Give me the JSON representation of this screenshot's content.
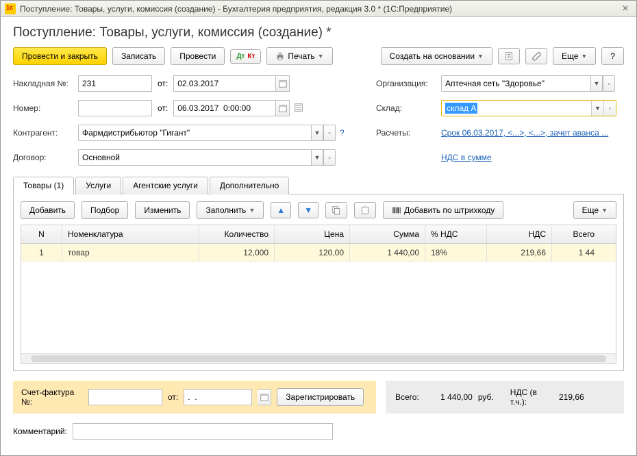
{
  "window": {
    "title": "Поступление: Товары, услуги, комиссия (создание) - Бухгалтерия предприятия, редакция 3.0 *  (1С:Предприятие)"
  },
  "heading": "Поступление: Товары, услуги, комиссия (создание) *",
  "toolbar": {
    "post_close": "Провести и закрыть",
    "save": "Записать",
    "post": "Провести",
    "print": "Печать",
    "create_based": "Создать на основании",
    "more": "Еще",
    "help": "?"
  },
  "form": {
    "invoice_no_label": "Накладная  №:",
    "invoice_no": "231",
    "from1": "от:",
    "date1": "02.03.2017",
    "number_label": "Номер:",
    "number_value": "",
    "from2": "от:",
    "date2": "06.03.2017  0:00:00",
    "contractor_label": "Контрагент:",
    "contractor": "Фармдистрибьютор \"Гигант\"",
    "contract_label": "Договор:",
    "contract": "Основной",
    "org_label": "Организация:",
    "org": "Аптечная сеть \"Здоровье\"",
    "warehouse_label": "Склад:",
    "warehouse_value": "склад А",
    "calc_label": "Расчеты:",
    "calc_link": "Срок 06.03.2017, <...>, <...>, зачет аванса ...",
    "vat_link": "НДС в сумме"
  },
  "tabs": {
    "goods": "Товары (1)",
    "services": "Услуги",
    "agent": "Агентские услуги",
    "extra": "Дополнительно"
  },
  "tbl_toolbar": {
    "add": "Добавить",
    "select": "Подбор",
    "change": "Изменить",
    "fill": "Заполнить",
    "barcode": "Добавить по штрихкоду",
    "more": "Еще"
  },
  "columns": {
    "n": "N",
    "nom": "Номенклатура",
    "qty": "Количество",
    "price": "Цена",
    "sum": "Сумма",
    "vatp": "% НДС",
    "vat": "НДС",
    "total": "Всего"
  },
  "rows": [
    {
      "n": "1",
      "nom": "товар",
      "qty": "12,000",
      "price": "120,00",
      "sum": "1 440,00",
      "vatp": "18%",
      "vat": "219,66",
      "total": "1 44"
    }
  ],
  "invoice": {
    "label": "Счет-фактура №:",
    "no": "",
    "from": "от:",
    "date": ".  .",
    "register": "Зарегистрировать"
  },
  "totals": {
    "total_label": "Всего:",
    "total": "1 440,00",
    "currency": "руб.",
    "vat_label": "НДС (в т.ч.):",
    "vat": "219,66"
  },
  "comment_label": "Комментарий:",
  "comment_value": ""
}
